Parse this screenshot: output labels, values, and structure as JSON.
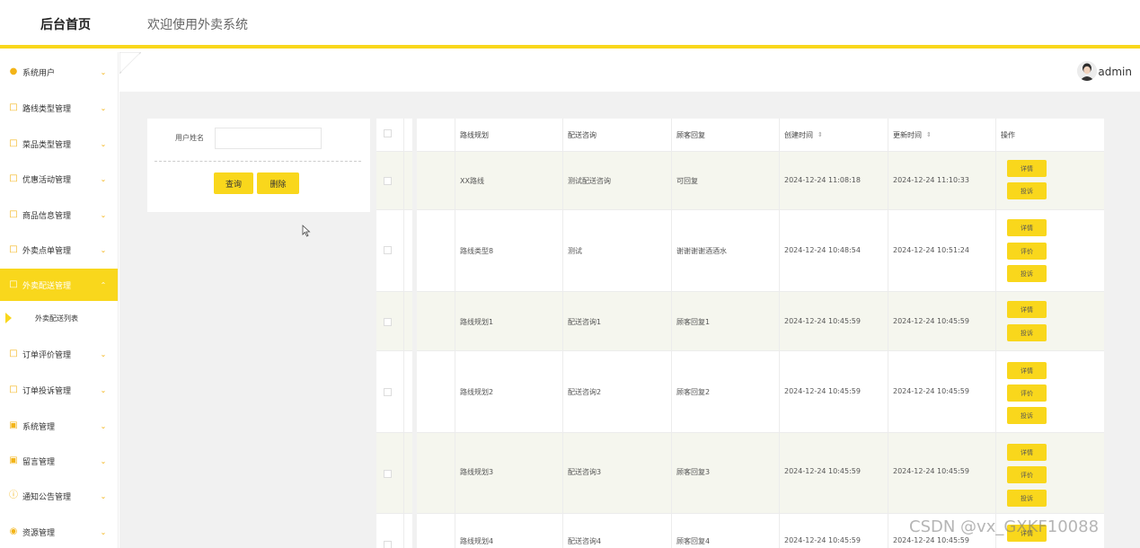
{
  "header": {
    "logo": "后台首页",
    "welcome": "欢迎使用外卖系统"
  },
  "sidebar": {
    "items": [
      {
        "label": "系统用户",
        "icon": "user-icon"
      },
      {
        "label": "路线类型管理",
        "icon": "folder-icon"
      },
      {
        "label": "菜品类型管理",
        "icon": "folder-icon"
      },
      {
        "label": "优惠活动管理",
        "icon": "folder-icon"
      },
      {
        "label": "商品信息管理",
        "icon": "folder-icon"
      },
      {
        "label": "外卖点单管理",
        "icon": "folder-icon"
      },
      {
        "label": "外卖配送管理",
        "icon": "folder-icon",
        "active": true
      },
      {
        "label": "订单评价管理",
        "icon": "folder-icon"
      },
      {
        "label": "订单投诉管理",
        "icon": "folder-icon"
      },
      {
        "label": "系统管理",
        "icon": "image-icon"
      },
      {
        "label": "留言管理",
        "icon": "image-icon"
      },
      {
        "label": "通知公告管理",
        "icon": "info-icon"
      },
      {
        "label": "资源管理",
        "icon": "location-icon"
      }
    ],
    "submenu": {
      "label": "外卖配送列表"
    }
  },
  "topbar": {
    "user": "admin"
  },
  "search": {
    "label": "用户姓名",
    "value": "",
    "placeholder": "",
    "query_button": "查询",
    "delete_button": "删除"
  },
  "table": {
    "headers": [
      "路线规划",
      "配送咨询",
      "顾客回复",
      "创建时间",
      "更新时间",
      "操作"
    ],
    "rows": [
      {
        "route": "XX路线",
        "consult": "测试配送咨询",
        "reply": "可回复",
        "created": "2024-12-24 11:08:18",
        "updated": "2024-12-24 11:10:33",
        "actions": [
          "详情",
          "投诉"
        ]
      },
      {
        "route": "路线类型8",
        "consult": "测试",
        "reply": "谢谢谢谢酒酒水",
        "created": "2024-12-24 10:48:54",
        "updated": "2024-12-24 10:51:24",
        "actions": [
          "详情",
          "评价",
          "投诉"
        ]
      },
      {
        "route": "路线规划1",
        "consult": "配送咨询1",
        "reply": "顾客回复1",
        "created": "2024-12-24 10:45:59",
        "updated": "2024-12-24 10:45:59",
        "actions": [
          "详情",
          "投诉"
        ]
      },
      {
        "route": "路线规划2",
        "consult": "配送咨询2",
        "reply": "顾客回复2",
        "created": "2024-12-24 10:45:59",
        "updated": "2024-12-24 10:45:59",
        "actions": [
          "详情",
          "评价",
          "投诉"
        ]
      },
      {
        "route": "路线规划3",
        "consult": "配送咨询3",
        "reply": "顾客回复3",
        "created": "2024-12-24 10:45:59",
        "updated": "2024-12-24 10:45:59",
        "actions": [
          "详情",
          "评价",
          "投诉"
        ]
      },
      {
        "route": "路线规划4",
        "consult": "配送咨询4",
        "reply": "顾客回复4",
        "created": "2024-12-24 10:45:59",
        "updated": "2024-12-24 10:45:59",
        "actions": [
          "详情"
        ]
      }
    ]
  },
  "watermark": "CSDN @vx_GXKF10088",
  "colors": {
    "accent": "#f9d71c",
    "row_alt": "#f5f6ee",
    "background": "#f1f1f1"
  }
}
